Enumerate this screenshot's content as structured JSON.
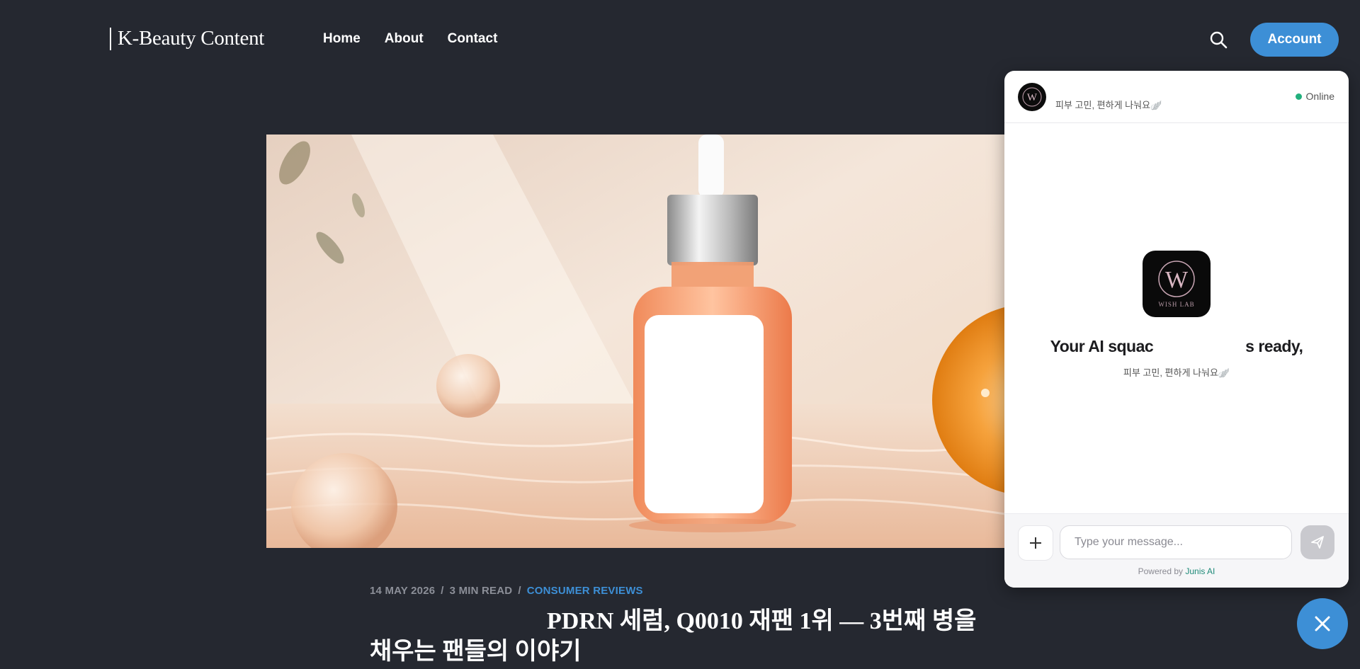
{
  "header": {
    "brand": "K-Beauty Content",
    "nav": [
      "Home",
      "About",
      "Contact"
    ],
    "search_icon": "search-icon",
    "account_label": "Account"
  },
  "hero": {
    "icon": "serum-bottle-photo"
  },
  "article": {
    "date": "14 MAY 2026",
    "read_time": "3 MIN READ",
    "separator": "/",
    "category": "CONSUMER REVIEWS",
    "title": "PDRN 세럼, Q0010 재팬 1위 — 3번째 병을 채우는 팬들의 이야기"
  },
  "chat": {
    "header_subtitle": "피부 고민, 편하게 나눠요🪽",
    "status": "Online",
    "status_color": "#22b07d",
    "logo_text": "WISH LAB",
    "logo_letter": "W",
    "ready_left": "Your AI squac",
    "ready_right": "s ready,",
    "tagline": "피부 고민, 편하게 나눠요🪽",
    "input_placeholder": "Type your message...",
    "powered_prefix": "Powered by",
    "powered_brand": "Junis AI"
  },
  "colors": {
    "background": "#252830",
    "accent": "#3d8fd6",
    "meta": "#8c8f98"
  }
}
